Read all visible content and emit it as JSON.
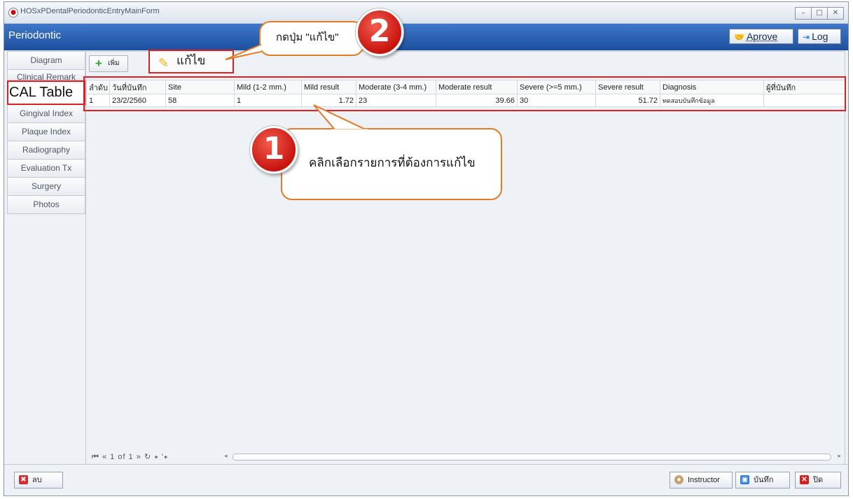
{
  "window": {
    "title": "HOSxPDentalPeriodonticEntryMainForm",
    "controls": [
      "–",
      "□",
      "✕"
    ]
  },
  "header": {
    "title": "Periodontic",
    "approve_label": "Aprove",
    "log_label": "Log"
  },
  "sidebar": {
    "items": [
      {
        "label": "Diagram"
      },
      {
        "label": "Clinical Remark"
      },
      {
        "label": "CAL Table"
      },
      {
        "label": "Gingival Index"
      },
      {
        "label": "Plaque Index"
      },
      {
        "label": "Radiography"
      },
      {
        "label": "Evaluation Tx"
      },
      {
        "label": "Surgery"
      },
      {
        "label": "Photos"
      }
    ],
    "active_index": 2
  },
  "toolbar": {
    "add_label": "เพิ่ม",
    "edit_label": "แก้ไข"
  },
  "grid": {
    "columns": [
      "ลำดับ",
      "วันที่บันทึก",
      "Site",
      "Mild (1-2 mm.)",
      "Mild result",
      "Moderate (3-4 mm.)",
      "Moderate result",
      "Severe (>=5 mm.)",
      "Severe result",
      "Diagnosis",
      "ผู้ที่บันทึก"
    ],
    "rows": [
      [
        "1",
        "23/2/2560",
        "58",
        "1",
        "1.72",
        "23",
        "39.66",
        "30",
        "51.72",
        "ทดสอบบันทึกข้อมูล",
        ""
      ]
    ]
  },
  "pager": {
    "text": "1 of 1"
  },
  "footer": {
    "delete_label": "ลบ",
    "instructor_label": "Instructor",
    "save_label": "บันทึก",
    "close_label": "ปิด"
  },
  "callouts": {
    "step1_number": "1",
    "step1_text": "คลิกเลือกรายการที่ต้องการแก้ไข",
    "step2_number": "2",
    "step2_text": "กดปุ่ม \"แก้ไข\""
  },
  "colors": {
    "header_blue": "#1d4f9e",
    "highlight_red": "#e21f1f",
    "callout_border": "#e27a26"
  }
}
